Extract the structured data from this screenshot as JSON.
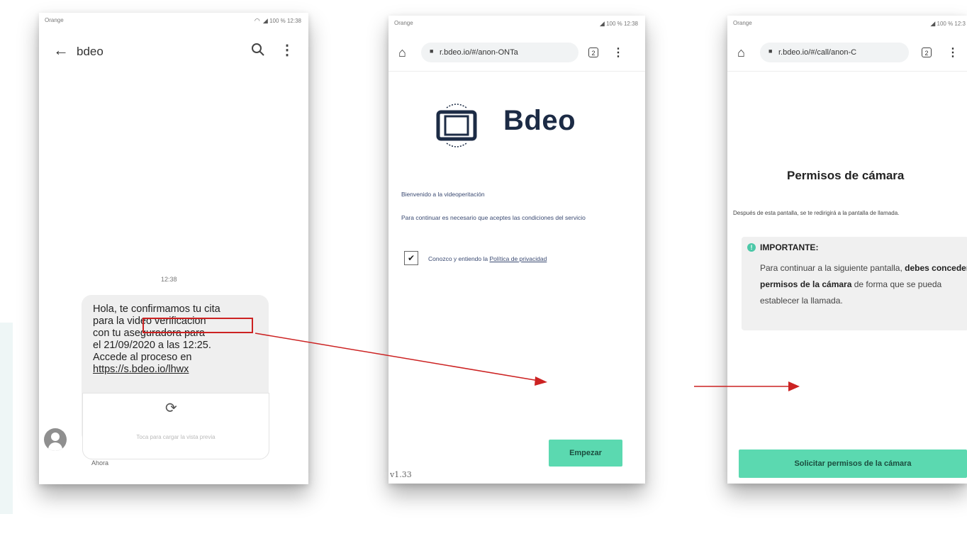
{
  "phone1": {
    "status": {
      "carrier": "Orange",
      "right": "100 % 12:38"
    },
    "contact_name": "bdeo",
    "message_time": "12:38",
    "message_lines": [
      "Hola, te confirmamos tu cita",
      "para la video verificacion",
      "con tu aseguradora para",
      "el 21/09/2020 a las 12:25.",
      "Accede al proceso en"
    ],
    "message_link": "https://s.bdeo.io/lhwx",
    "preview_label": "Toca para cargar la vista previa",
    "sent_label": "Ahora"
  },
  "phone2": {
    "status": {
      "carrier": "Orange",
      "right": "100 % 12:38"
    },
    "url": "r.bdeo.io/#/anon-ONTa",
    "tab_count": "2",
    "logo_text": "Bdeo",
    "welcome": "Bienvenido a la videoperitación",
    "conditions": "Para continuar es necesario que aceptes las condiciones del servicio",
    "checkbox_label": "Conozco y entiendo la",
    "policy_link": "Política de privacidad",
    "checkbox_checked": true,
    "start_button": "Empezar",
    "version": "v1.33",
    "accent_color": "#5bd9b0"
  },
  "phone3": {
    "status": {
      "carrier": "Orange",
      "right": "100 % 12:3"
    },
    "url": "r.bdeo.io/#/call/anon-C",
    "tab_count": "2",
    "title": "Permisos de cámara",
    "description": "Después de esta pantalla, se te redirigirá a la pantalla de llamada.",
    "important_title": "IMPORTANTE:",
    "important_text_1": "Para continuar a la siguiente pantalla,",
    "important_text_bold": "debes conceder permisos de la cámara",
    "important_text_2": "de forma que se pueda establecer la llamada.",
    "request_button": "Solicitar permisos de la cámara",
    "accent_color": "#5bd9b0"
  },
  "icons": {
    "back": "←",
    "search": "search-icon",
    "more": "⋮",
    "reload": "⟳",
    "home": "⌂",
    "lock": "🔒",
    "check": "✔",
    "info": "!"
  }
}
